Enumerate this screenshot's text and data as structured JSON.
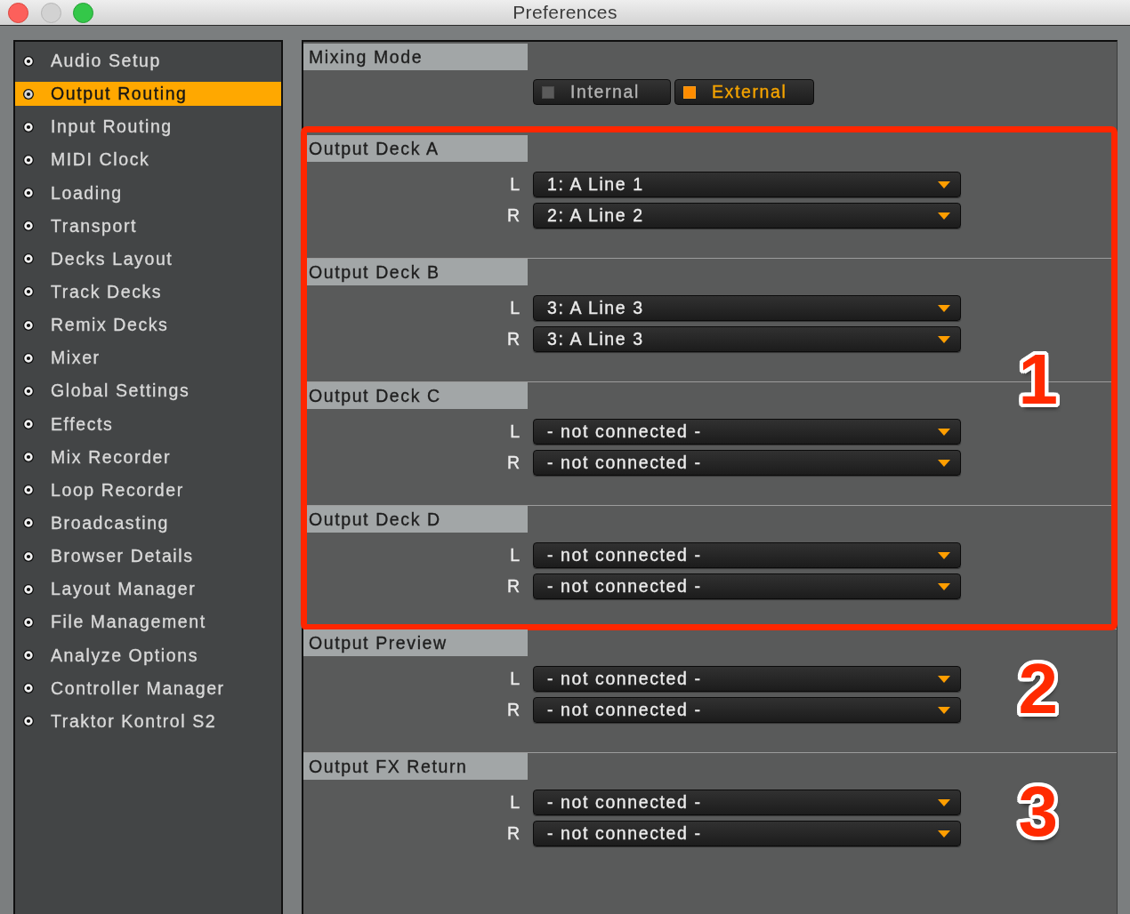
{
  "window": {
    "title": "Preferences"
  },
  "sidebar": {
    "items": [
      {
        "label": "Audio Setup",
        "selected": false
      },
      {
        "label": "Output Routing",
        "selected": true
      },
      {
        "label": "Input Routing",
        "selected": false
      },
      {
        "label": "MIDI Clock",
        "selected": false
      },
      {
        "label": "Loading",
        "selected": false
      },
      {
        "label": "Transport",
        "selected": false
      },
      {
        "label": "Decks Layout",
        "selected": false
      },
      {
        "label": "Track Decks",
        "selected": false
      },
      {
        "label": "Remix Decks",
        "selected": false
      },
      {
        "label": "Mixer",
        "selected": false
      },
      {
        "label": "Global Settings",
        "selected": false
      },
      {
        "label": "Effects",
        "selected": false
      },
      {
        "label": "Mix Recorder",
        "selected": false
      },
      {
        "label": "Loop Recorder",
        "selected": false
      },
      {
        "label": "Broadcasting",
        "selected": false
      },
      {
        "label": "Browser Details",
        "selected": false
      },
      {
        "label": "Layout Manager",
        "selected": false
      },
      {
        "label": "File Management",
        "selected": false
      },
      {
        "label": "Analyze Options",
        "selected": false
      },
      {
        "label": "Controller Manager",
        "selected": false
      },
      {
        "label": "Traktor Kontrol S2",
        "selected": false
      }
    ]
  },
  "mixing_mode": {
    "title": "Mixing Mode",
    "options": [
      {
        "label": "Internal",
        "selected": false
      },
      {
        "label": "External",
        "selected": true
      }
    ]
  },
  "routing_groups": [
    {
      "highlighted": true,
      "marker": "1",
      "sections": [
        {
          "title": "Output Deck A",
          "channels": [
            {
              "label": "L",
              "value": "1: A Line 1"
            },
            {
              "label": "R",
              "value": "2: A Line 2"
            }
          ]
        },
        {
          "title": "Output Deck B",
          "channels": [
            {
              "label": "L",
              "value": "3: A Line 3"
            },
            {
              "label": "R",
              "value": "3: A Line 3"
            }
          ]
        },
        {
          "title": "Output Deck C",
          "channels": [
            {
              "label": "L",
              "value": "- not connected -"
            },
            {
              "label": "R",
              "value": "- not connected -"
            }
          ]
        },
        {
          "title": "Output Deck D",
          "channels": [
            {
              "label": "L",
              "value": "- not connected -"
            },
            {
              "label": "R",
              "value": "- not connected -"
            }
          ]
        }
      ]
    },
    {
      "highlighted": false,
      "marker": "2",
      "sections": [
        {
          "title": "Output Preview",
          "channels": [
            {
              "label": "L",
              "value": "- not connected -"
            },
            {
              "label": "R",
              "value": "- not connected -"
            }
          ]
        }
      ]
    },
    {
      "highlighted": false,
      "marker": "3",
      "sections": [
        {
          "title": "Output FX Return",
          "channels": [
            {
              "label": "L",
              "value": "- not connected -"
            },
            {
              "label": "R",
              "value": "- not connected -"
            }
          ]
        }
      ]
    }
  ]
}
